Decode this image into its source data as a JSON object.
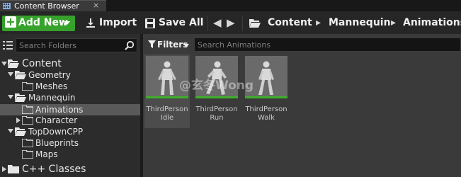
{
  "tab": {
    "title": "Content Browser",
    "close": "×"
  },
  "toolbar": {
    "add_new": "Add New",
    "import": "Import",
    "save_all": "Save All",
    "breadcrumbs": [
      "Content",
      "Mannequin",
      "Animations"
    ],
    "breadcrumb_separator": "▸"
  },
  "sidebar": {
    "search_placeholder": "Search Folders",
    "tree": [
      {
        "label": "Content",
        "expanded": true,
        "selected": false
      },
      {
        "label": "Geometry",
        "expanded": true,
        "selected": false
      },
      {
        "label": "Meshes",
        "selected": false
      },
      {
        "label": "Mannequin",
        "expanded": true,
        "selected": false
      },
      {
        "label": "Animations",
        "selected": true
      },
      {
        "label": "Character",
        "expanded": false,
        "selected": false
      },
      {
        "label": "TopDownCPP",
        "expanded": true,
        "selected": false
      },
      {
        "label": "Blueprints",
        "selected": false
      },
      {
        "label": "Maps",
        "selected": false
      },
      {
        "label": "C++ Classes",
        "expanded": false,
        "selected": false
      }
    ]
  },
  "filters": {
    "label": "Filters"
  },
  "asset_search": {
    "placeholder": "Search Animations"
  },
  "assets": [
    {
      "line1": "ThirdPerson",
      "line2": "Idle"
    },
    {
      "line1": "ThirdPerson",
      "line2": "Run"
    },
    {
      "line1": "ThirdPerson",
      "line2": "Walk"
    }
  ],
  "watermark": "@玄冬Wong",
  "colors": {
    "accent_green": "#36a12b",
    "selected_row": "#595959",
    "thumb_bg": "#6a6a6a"
  }
}
